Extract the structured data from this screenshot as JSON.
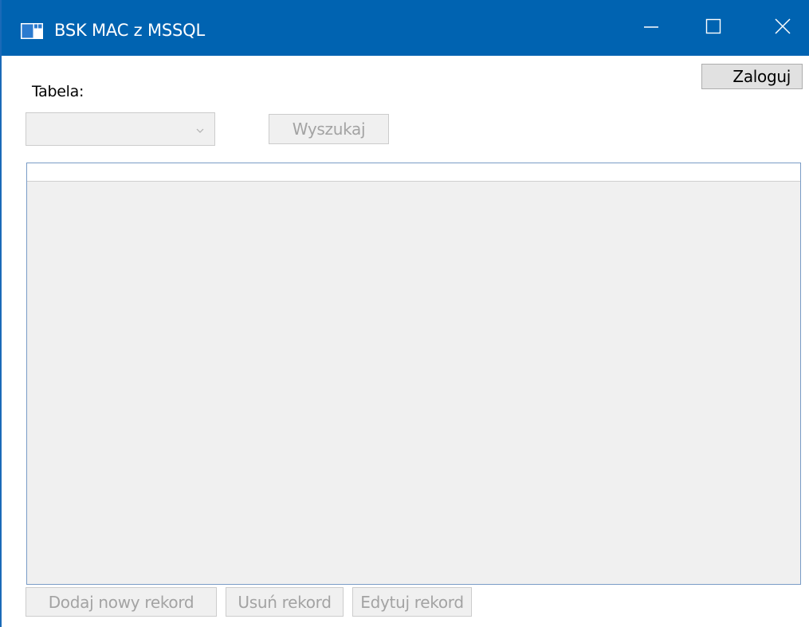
{
  "window": {
    "title": "BSK MAC z MSSQL",
    "icon": "app-window-icon",
    "caption_buttons": [
      "minimize-icon",
      "maximize-icon",
      "close-icon"
    ]
  },
  "toolbar": {
    "login_label": "Zaloguj",
    "table_label": "Tabela:",
    "table_select_value": "",
    "search_label": "Wyszukaj"
  },
  "grid": {
    "columns": [],
    "rows": []
  },
  "actions": {
    "add_label": "Dodaj nowy rekord",
    "delete_label": "Usuń rekord",
    "edit_label": "Edytuj rekord"
  },
  "colors": {
    "titlebar": "#0063b1",
    "disabled_text": "#a3a3a3",
    "grid_border": "#7a9cc6"
  }
}
